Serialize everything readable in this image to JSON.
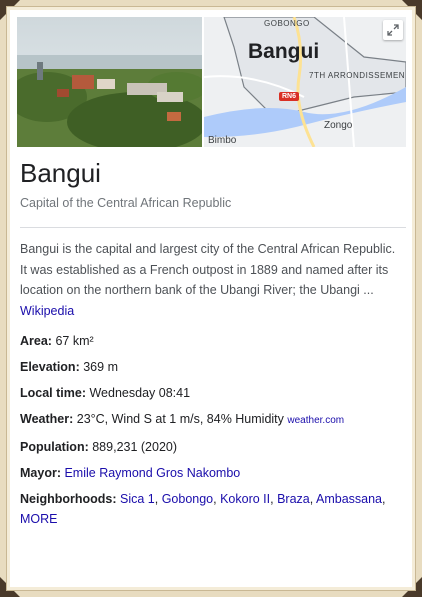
{
  "map": {
    "city_label": "Bangui",
    "labels": {
      "gobongo": "GOBONGO",
      "arrondissement": "7TH ARRONDISSEMEN",
      "zongo": "Zongo",
      "bimbo": "Bimbo",
      "road": "RN6"
    }
  },
  "header": {
    "title": "Bangui",
    "subtitle": "Capital of the Central African Republic"
  },
  "description": {
    "text": "Bangui is the capital and largest city of the Central African Republic. It was established as a French outpost in 1889 and named after its location on the northern bank of the Ubangi River; the Ubangi ...",
    "source_link": "Wikipedia"
  },
  "facts": {
    "area": {
      "label": "Area:",
      "value": "67 km²"
    },
    "elevation": {
      "label": "Elevation:",
      "value": "369 m"
    },
    "local_time": {
      "label": "Local time:",
      "value": "Wednesday 08:41"
    },
    "weather": {
      "label": "Weather:",
      "value": "23°C, Wind S at 1 m/s, 84% Humidity",
      "source": "weather.com"
    },
    "population": {
      "label": "Population:",
      "value": "889,231 (2020)"
    },
    "mayor": {
      "label": "Mayor:",
      "value": "Emile Raymond Gros Nakombo"
    },
    "neighborhoods": {
      "label": "Neighborhoods:",
      "items": [
        "Sica 1",
        "Gobongo",
        "Kokoro II",
        "Braza",
        "Ambassana"
      ],
      "more": "MORE"
    }
  },
  "colors": {
    "link": "#1a0dab",
    "frame": "#e8dcc0",
    "corner": "#4a3a2a"
  }
}
